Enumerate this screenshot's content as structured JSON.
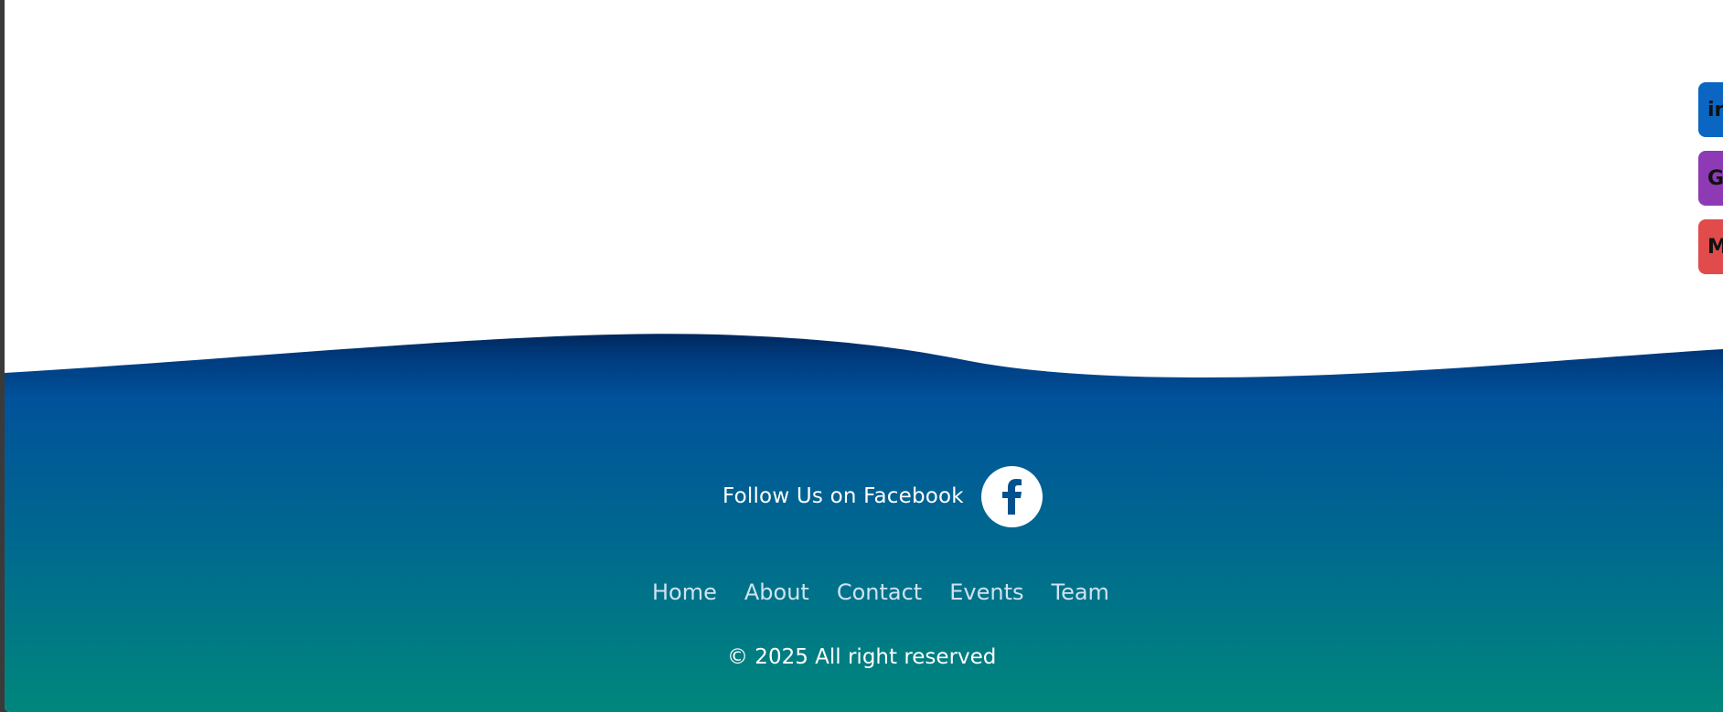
{
  "footer": {
    "follow_text": "Follow Us on Facebook",
    "facebook_icon": "facebook-f-icon",
    "nav": [
      {
        "label": "Home"
      },
      {
        "label": "About"
      },
      {
        "label": "Contact"
      },
      {
        "label": "Events"
      },
      {
        "label": "Team"
      }
    ],
    "copyright": "© 2025 All right reserved"
  },
  "side_social": [
    {
      "icon": "linkedin-icon",
      "glyph": "in",
      "color": "#0a66c2"
    },
    {
      "icon": "github-icon",
      "glyph": "G",
      "color": "#8e3ab5"
    },
    {
      "icon": "medium-icon",
      "glyph": "M",
      "color": "#e14b4b"
    }
  ],
  "colors": {
    "wave_top": "#00275a",
    "footer_mid": "#00529a",
    "footer_bottom": "#00877c",
    "page_bg": "#ffffff"
  }
}
